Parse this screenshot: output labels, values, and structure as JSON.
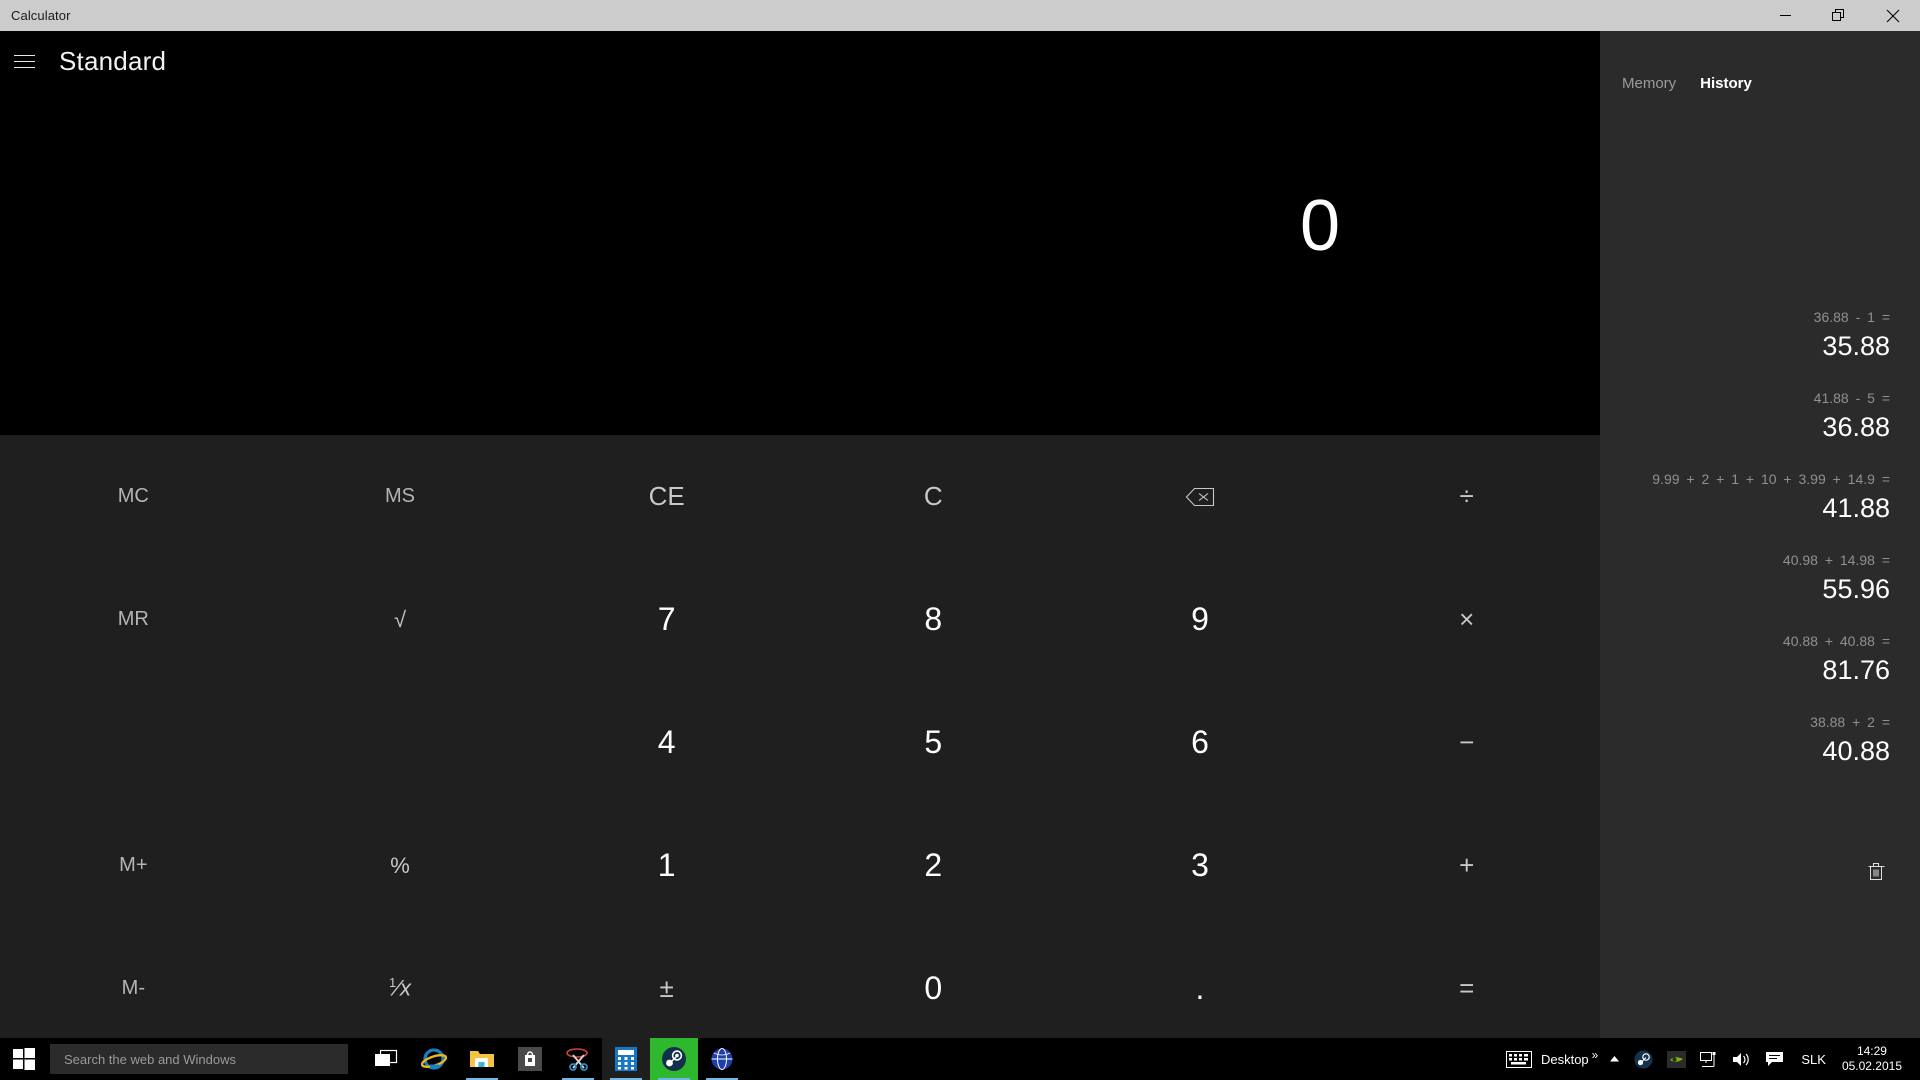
{
  "window": {
    "title": "Calculator",
    "minimize_icon": "minimize-icon",
    "restore_icon": "restore-icon",
    "close_icon": "close-icon"
  },
  "app": {
    "menu_icon": "hamburger-menu-icon",
    "mode_title": "Standard",
    "display_value": "0"
  },
  "keypad": {
    "rows": [
      [
        {
          "label": "MC",
          "name": "memory-clear-button",
          "cls": "mem"
        },
        {
          "label": "MS",
          "name": "memory-store-button",
          "cls": "mem"
        },
        {
          "label": "CE",
          "name": "clear-entry-button",
          "cls": "op"
        },
        {
          "label": "C",
          "name": "clear-button",
          "cls": "op"
        },
        {
          "label": "⌫",
          "name": "backspace-icon",
          "cls": "op"
        },
        {
          "label": "÷",
          "name": "divide-button",
          "cls": "op"
        }
      ],
      [
        {
          "label": "MR",
          "name": "memory-recall-button",
          "cls": "mem"
        },
        {
          "label": "√",
          "name": "square-root-button",
          "cls": "fun"
        },
        {
          "label": "7",
          "name": "digit-7-button",
          "cls": "num"
        },
        {
          "label": "8",
          "name": "digit-8-button",
          "cls": "num"
        },
        {
          "label": "9",
          "name": "digit-9-button",
          "cls": "num"
        },
        {
          "label": "×",
          "name": "multiply-button",
          "cls": "op"
        }
      ],
      [
        {
          "label": "",
          "name": "empty-cell",
          "cls": "blank"
        },
        {
          "label": "",
          "name": "empty-cell",
          "cls": "blank"
        },
        {
          "label": "4",
          "name": "digit-4-button",
          "cls": "num"
        },
        {
          "label": "5",
          "name": "digit-5-button",
          "cls": "num"
        },
        {
          "label": "6",
          "name": "digit-6-button",
          "cls": "num"
        },
        {
          "label": "−",
          "name": "subtract-button",
          "cls": "op"
        }
      ],
      [
        {
          "label": "M+",
          "name": "memory-add-button",
          "cls": "mem"
        },
        {
          "label": "%",
          "name": "percent-button",
          "cls": "fun"
        },
        {
          "label": "1",
          "name": "digit-1-button",
          "cls": "num"
        },
        {
          "label": "2",
          "name": "digit-2-button",
          "cls": "num"
        },
        {
          "label": "3",
          "name": "digit-3-button",
          "cls": "num"
        },
        {
          "label": "+",
          "name": "add-button",
          "cls": "op"
        }
      ],
      [
        {
          "label": "M-",
          "name": "memory-subtract-button",
          "cls": "mem"
        },
        {
          "label": "1/x",
          "name": "reciprocal-button",
          "cls": "fun"
        },
        {
          "label": "±",
          "name": "plus-minus-button",
          "cls": "op"
        },
        {
          "label": "0",
          "name": "digit-0-button",
          "cls": "num"
        },
        {
          "label": ".",
          "name": "decimal-point-button",
          "cls": "num"
        },
        {
          "label": "=",
          "name": "equals-button",
          "cls": "op"
        }
      ]
    ]
  },
  "panel": {
    "tab_memory": "Memory",
    "tab_history": "History",
    "clear_icon": "trash-icon",
    "history": [
      {
        "expression": "36.88  -  1 =",
        "result": "35.88"
      },
      {
        "expression": "41.88  -  5 =",
        "result": "36.88"
      },
      {
        "expression": "9.99  +  2  +  1  +  10  +  3.99  +  14.9 =",
        "result": "41.88"
      },
      {
        "expression": "40.98  +  14.98 =",
        "result": "55.96"
      },
      {
        "expression": "40.88  +  40.88 =",
        "result": "81.76"
      },
      {
        "expression": "38.88  +  2 =",
        "result": "40.88"
      }
    ]
  },
  "taskbar": {
    "start_icon": "windows-start-icon",
    "search_placeholder": "Search the web and Windows",
    "buttons": [
      {
        "name": "task-view-button",
        "icon": "task-view-icon"
      },
      {
        "name": "internet-explorer-button",
        "icon": "internet-explorer-icon"
      },
      {
        "name": "file-explorer-button",
        "icon": "folder-icon"
      },
      {
        "name": "store-button",
        "icon": "store-bag-icon"
      },
      {
        "name": "snipping-tool-button",
        "icon": "scissors-icon"
      },
      {
        "name": "calculator-button",
        "icon": "calculator-icon"
      },
      {
        "name": "steam-button",
        "icon": "steam-icon"
      },
      {
        "name": "browser-button",
        "icon": "globe-icon"
      }
    ],
    "tray": {
      "keyboard_icon": "keyboard-icon",
      "desktop_label": "Desktop",
      "overflow_icon": "chevron-double-right-icon",
      "show_hidden_icon": "chevron-up-icon",
      "steam_icon": "steam-tray-icon",
      "nvidia_icon": "nvidia-icon",
      "network_icon": "network-icon",
      "volume_icon": "volume-icon",
      "action_center_icon": "action-center-icon",
      "language": "SLK",
      "time": "14:29",
      "date": "05.02.2015"
    }
  },
  "colors": {
    "titlebar": "#cccccc",
    "display_bg": "#000000",
    "keypad_bg": "#1f1f1f",
    "panel_bg": "#2b2b2b",
    "accent": "#6fb8e8"
  }
}
